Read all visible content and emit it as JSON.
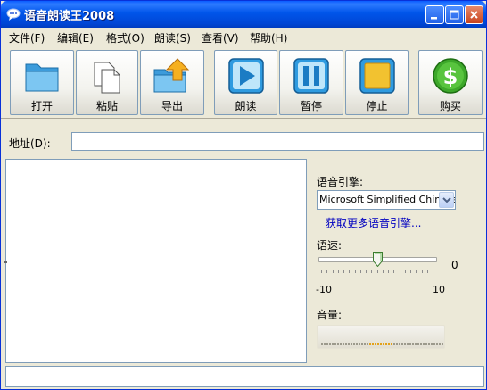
{
  "window": {
    "title": "语音朗读王2008",
    "icon": "speech-bubble-icon",
    "controls": [
      "minimize-icon",
      "maximize-icon",
      "close-icon"
    ]
  },
  "menu": {
    "items": [
      "文件(F)",
      "编辑(E)",
      "格式(O)",
      "朗读(S)",
      "查看(V)",
      "帮助(H)"
    ]
  },
  "toolbar": {
    "buttons": [
      {
        "label": "打开",
        "icon": "folder-icon"
      },
      {
        "label": "粘贴",
        "icon": "paste-icon"
      },
      {
        "label": "导出",
        "icon": "export-icon"
      },
      {
        "label": "朗读",
        "icon": "play-icon"
      },
      {
        "label": "暂停",
        "icon": "pause-icon"
      },
      {
        "label": "停止",
        "icon": "stop-icon"
      },
      {
        "label": "购买",
        "icon": "dollar-icon"
      }
    ]
  },
  "address": {
    "label": "地址(D):",
    "value": ""
  },
  "text_area": {
    "value": ""
  },
  "engine": {
    "label": "语音引擎:",
    "selected": "Microsoft Simplified Chinese",
    "more_link": "获取更多语音引擎..."
  },
  "speed": {
    "label": "语速:",
    "value": "0",
    "min_label": "-10",
    "max_label": "10",
    "min": -10,
    "max": 10,
    "current": 0
  },
  "volume": {
    "label": "音量:"
  },
  "colors": {
    "title_bar": "#0055EA",
    "window_bg": "#ECE9D8",
    "link": "#0000C0",
    "play_accent": "#1E9EE0",
    "stop_accent": "#F2C230",
    "buy_accent": "#3DA82A"
  }
}
